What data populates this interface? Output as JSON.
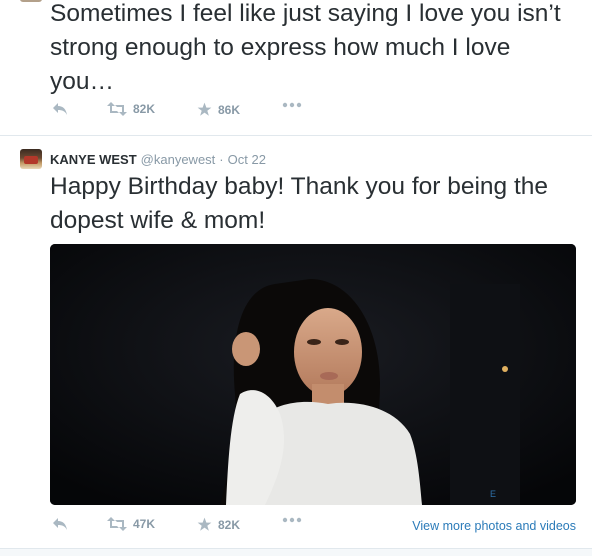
{
  "tweets": [
    {
      "text": "Sometimes I feel like just saying I love you isn’t strong enough to express how much I love you…",
      "actions": {
        "retweets": "82K",
        "favorites": "86K"
      }
    },
    {
      "author": {
        "name": "KANYE WEST",
        "handle": "@kanyewest",
        "separator": "·",
        "time": "Oct 22"
      },
      "text": "Happy Birthday baby!  Thank you for being the dopest wife & mom!",
      "actions": {
        "retweets": "47K",
        "favorites": "82K"
      },
      "view_more": "View more photos and videos"
    }
  ],
  "icons": {
    "reply": "reply-icon",
    "retweet": "retweet-icon",
    "favorite": "star-icon",
    "more": "more-dots-icon"
  },
  "colors": {
    "text": "#292f33",
    "muted": "#8899a6",
    "link": "#2b7bb9",
    "background": "#f5f8fa"
  }
}
